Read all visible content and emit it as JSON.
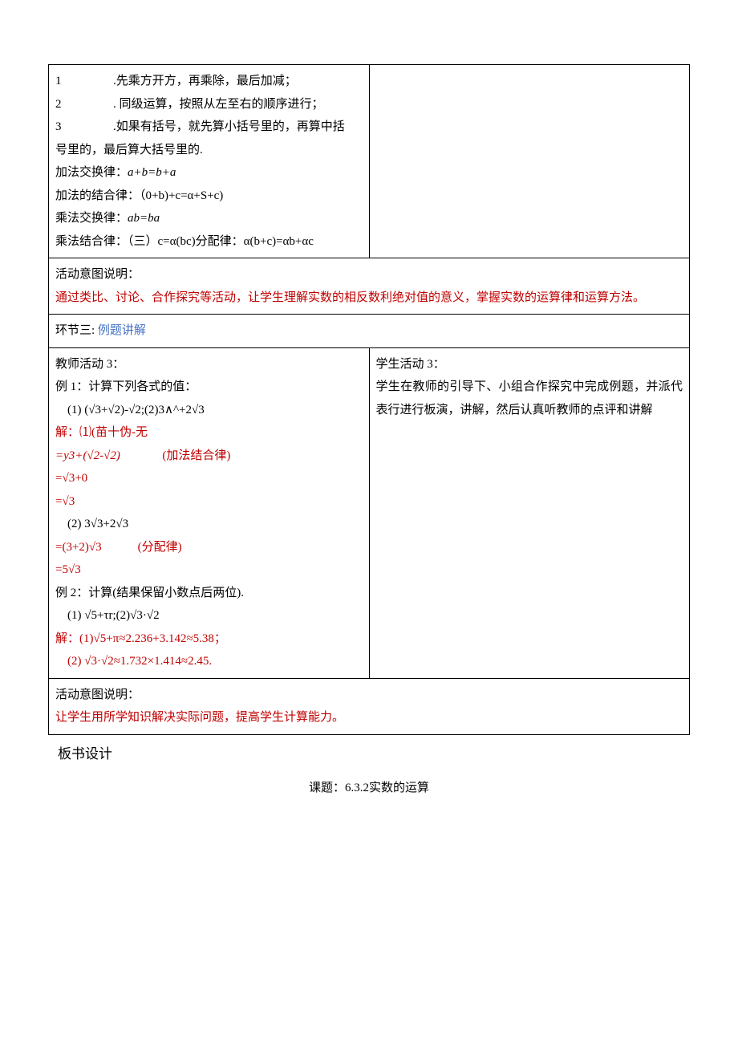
{
  "box1": {
    "left": {
      "items": [
        {
          "num": "1",
          "text": ".先乘方开方，再乘除，最后加减；"
        },
        {
          "num": "2",
          "text": ". 同级运算，按照从左至右的顺序进行；"
        },
        {
          "num": "3",
          "text": ".如果有括号，就先算小括号里的，再算中括"
        }
      ],
      "item3_cont": "号里的，最后算大括号里的.",
      "lines": [
        "加法交换律：a+b=b+a",
        "加法的结合律：（0+b)+c=α+S+c)",
        "乘法交换律：ab=ba",
        "乘法结合律：（三）c=α(bc)分配律：α(b+c)=αb+αc"
      ]
    }
  },
  "box2": {
    "title": "活动意图说明：",
    "body": "通过类比、讨论、合作探究等活动，让学生理解实数的相反数利绝对值的意义，掌握实数的运算律和运算方法。"
  },
  "box3": {
    "label": "环节三:",
    "title": "例题讲解"
  },
  "box4": {
    "left": {
      "l1": "教师活动 3：",
      "l2": "例 1：计算下列各式的值：",
      "l3": "(1)   (√3+√2)-√2;(2)3∧^+2√3",
      "l4": "解：⑴(苗十伪-无",
      "l5a": "=y3+(√2-√2)",
      "l5b": "(加法结合律)",
      "l6": "=√3+0",
      "l7": "=√3",
      "l8": "(2)   3√3+2√3",
      "l9a": "=(3+2)√3",
      "l9b": "(分配律)",
      "l10": "=5√3",
      "l11": "例 2：计算(结果保留小数点后两位).",
      "l12": "(1)   √5+τr;(2)√3·√2",
      "l13": "解：(1)√5+π≈2.236+3.142≈5.38；",
      "l14": "(2)   √3·√2≈1.732×1.414≈2.45."
    },
    "right": {
      "l1": "学生活动 3：",
      "l2": "学生在教师的引导下、小组合作探究中完成例题，并派代表行进行板演，讲解，然后认真听教师的点评和讲解"
    }
  },
  "box5": {
    "title": "活动意图说明：",
    "body": "让学生用所学知识解决实际问题，提高学生计算能力。"
  },
  "footer": {
    "heading": "板书设计",
    "title": "课题：6.3.2实数的运算"
  }
}
